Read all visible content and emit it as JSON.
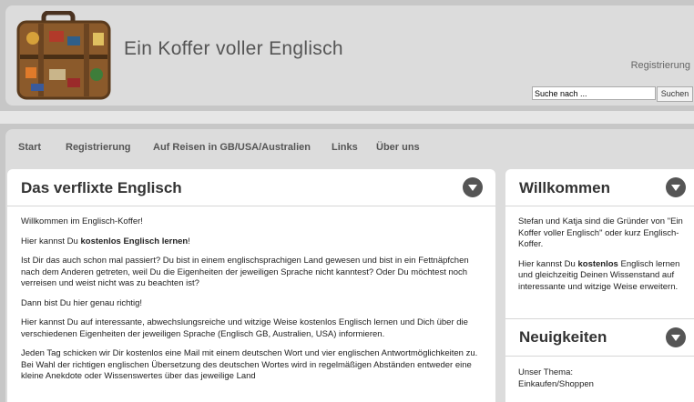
{
  "header": {
    "site_title": "Ein Koffer voller Englisch",
    "register_link": "Registrierung",
    "search_placeholder": "Suche nach ...",
    "search_button": "Suchen"
  },
  "nav": {
    "items": [
      "Start",
      "Registrierung",
      "Auf Reisen in GB/USA/Australien",
      "Links",
      "Über uns"
    ]
  },
  "main": {
    "title": "Das verflixte Englisch",
    "p1": "Willkommen im Englisch-Koffer!",
    "p2_pre": "Hier kannst Du ",
    "p2_bold": "kostenlos Englisch lernen",
    "p2_post": "!",
    "p3": "Ist Dir das auch schon mal passiert? Du bist in einem englischsprachigen Land gewesen und bist in ein Fettnäpfchen nach dem Anderen getreten, weil Du die Eigenheiten der jeweiligen Sprache nicht kanntest? Oder Du möchtest noch verreisen und weist nicht was zu beachten ist?",
    "p4": "Dann bist Du hier genau richtig!",
    "p5": "Hier kannst Du auf interessante, abwechslungsreiche und witzige Weise kostenlos Englisch lernen und Dich über die verschiedenen Eigenheiten der jeweiligen Sprache (Englisch GB, Australien, USA) informieren.",
    "p6": "Jeden Tag schicken wir Dir kostenlos eine Mail mit einem deutschen Wort und vier englischen Antwortmöglichkeiten zu. Bei Wahl der richtigen englischen Übersetzung des deutschen Wortes wird in regelmäßigen Abständen entweder eine kleine Anekdote oder Wissenswertes über das jeweilige Land"
  },
  "sidebar": {
    "welcome_title": "Willkommen",
    "welcome_p1": "Stefan und Katja sind die Gründer von \"Ein Koffer voller Englisch\" oder kurz Englisch-Koffer.",
    "welcome_p2_pre": "Hier kannst Du ",
    "welcome_p2_bold": "kostenlos",
    "welcome_p2_post": " Englisch lernen und gleichzeitig Deinen Wissenstand auf interessante und witzige Weise erweitern.",
    "news_title": "Neuigkeiten",
    "news_line1": "Unser Thema:",
    "news_line2": "Einkaufen/Shoppen"
  }
}
